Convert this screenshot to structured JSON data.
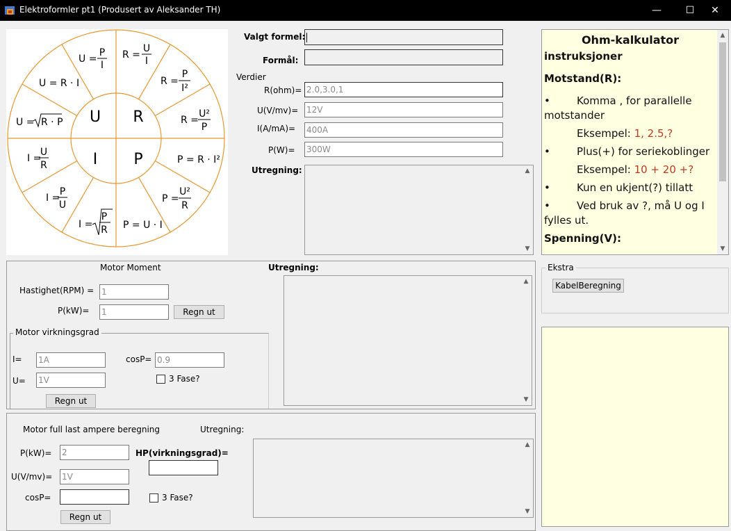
{
  "window": {
    "title": "Elektroformler pt1 (Produsert av Aleksander TH)",
    "minimize": "—",
    "maximize": "☐",
    "close": "✕"
  },
  "wheel": {
    "center": [
      "U",
      "R",
      "I",
      "P"
    ],
    "formulas": {
      "u_p_over_i": {
        "lhs": "U =",
        "num": "P",
        "den": "I"
      },
      "r_u_over_i": {
        "lhs": "R =",
        "num": "U",
        "den": "I"
      },
      "r_p_over_i2": {
        "lhs": "R =",
        "num": "P",
        "den": "I²"
      },
      "r_u2_over_p": {
        "lhs": "R =",
        "num": "U²",
        "den": "P"
      },
      "p_r_i2": "P = R · I²",
      "p_u2_over_r": {
        "lhs": "P =",
        "num": "U²",
        "den": "R"
      },
      "p_u_i": "P = U · I",
      "i_sqrt_p_over_r": {
        "lhs": "I =",
        "num": "P",
        "den": "R"
      },
      "i_p_over_u": {
        "lhs": "I =",
        "num": "P",
        "den": "U"
      },
      "i_u_over_r": {
        "lhs": "I =",
        "num": "U",
        "den": "R"
      },
      "u_sqrt_rp": {
        "lhs": "U =",
        "rad": "R · P"
      },
      "u_r_i": "U = R · I"
    }
  },
  "formula_panel": {
    "valgt_label": "Valgt formel:",
    "valgt_value": "",
    "formal_label": "Formål:",
    "formal_value": "",
    "verdier_label": "Verdier",
    "r_label": "R(ohm)=",
    "r_placeholder": "2.0,3.0,1",
    "u_label": "U(V/mv)=",
    "u_placeholder": "12V",
    "i_label": "I(A/mA)=",
    "i_placeholder": "400A",
    "p_label": "P(W)=",
    "p_placeholder": "300W",
    "utregning_label": "Utregning:"
  },
  "instructions": {
    "title": "Ohm-kalkulator",
    "subtitle": "instruksjoner",
    "section1": "Motstand(R):",
    "b1": "Komma , for parallelle",
    "b1b": "motstander",
    "ex_label": "Eksempel:",
    "ex1": "1, 2.5,?",
    "b2": "Plus(+) for seriekoblinger",
    "ex2": "10 + 20 +?",
    "b3": "Kun en ukjent(?) tillatt",
    "b4": "Ved bruk av ?, må U og I",
    "b4b": "fylles ut.",
    "section2": "Spenning(V):",
    "bullet": "•"
  },
  "motor_moment": {
    "title": "Motor Moment",
    "utregning_label": "Utregning:",
    "hastighet_label": "Hastighet(RPM) =",
    "hastighet_placeholder": "1",
    "pkw_label": "P(kW)=",
    "pkw_placeholder": "1",
    "regn_ut": "Regn ut"
  },
  "virkningsgrad": {
    "title": "Motor virkningsgrad",
    "i_label": "I=",
    "i_placeholder": "1A",
    "u_label": "U=",
    "u_placeholder": "1V",
    "cos_label": "cosP=",
    "cos_placeholder": "0.9",
    "fase_label": "3 Fase?",
    "regn_ut": "Regn ut"
  },
  "full_last": {
    "title": "Motor full last ampere beregning",
    "utregning_label": "Utregning:",
    "pkw_label": "P(kW)=",
    "pkw_placeholder": "2",
    "u_label": "U(V/mv)=",
    "u_placeholder": "1V",
    "cos_label": "cosP=",
    "cos_value": "",
    "hp_label": "HP(virkningsgrad)=",
    "hp_value": "",
    "fase_label": "3 Fase?",
    "regn_ut": "Regn ut"
  },
  "ekstra": {
    "title": "Ekstra",
    "kabel_button": "KabelBeregning"
  },
  "colors": {
    "wheel_line": "#e8962e",
    "heading_blue": "#1f3b73",
    "example_red": "#c0391f",
    "note_bg": "#ffffe1"
  }
}
